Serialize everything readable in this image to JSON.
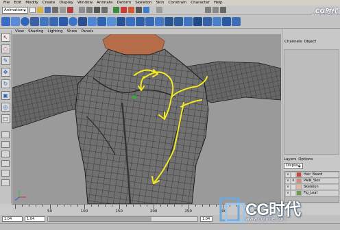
{
  "menu": [
    "File",
    "Edit",
    "Modify",
    "Create",
    "Display",
    "Window",
    "Animate",
    "Deform",
    "Skeleton",
    "Skin",
    "Constrain",
    "Character",
    "Help"
  ],
  "mode_select": "Animation",
  "viewport_menu": [
    "View",
    "Shading",
    "Lighting",
    "Show",
    "Panels"
  ],
  "right_panel": {
    "tabs": [
      "Channels",
      "Object"
    ],
    "layers_tabs": [
      "Layers",
      "Options"
    ],
    "display_select": "Display",
    "layers": [
      {
        "v": "V",
        "r": "",
        "name": "Hair_Beard",
        "color": "#c74a3a"
      },
      {
        "v": "V",
        "r": "R",
        "name": "PAIN_Skin",
        "color": "#d58a7a"
      },
      {
        "v": "V",
        "r": "",
        "name": "Skeleton",
        "color": "#e0b8a0"
      },
      {
        "v": "V",
        "r": "",
        "name": "Fig_Leaf",
        "color": "#6f9a53"
      }
    ]
  },
  "timeline": {
    "ticks": [
      "50",
      "100",
      "150",
      "200",
      "250",
      "300",
      "350"
    ],
    "tick_values": [
      50,
      100,
      150,
      200,
      250,
      300,
      350
    ],
    "max": 380,
    "current": "1.04"
  },
  "range": {
    "start": "1.04",
    "start2": "1.04",
    "end": "1.04"
  },
  "watermark": {
    "top": "CG时代",
    "top_sub": "www.hxsd.com",
    "brand": "CG时代",
    "url": "www.cgtime.com"
  },
  "colors": {
    "arrow": "#f2e823",
    "wire": "#222222",
    "skin": "#6e6e6e",
    "hair": "#b56c48"
  }
}
